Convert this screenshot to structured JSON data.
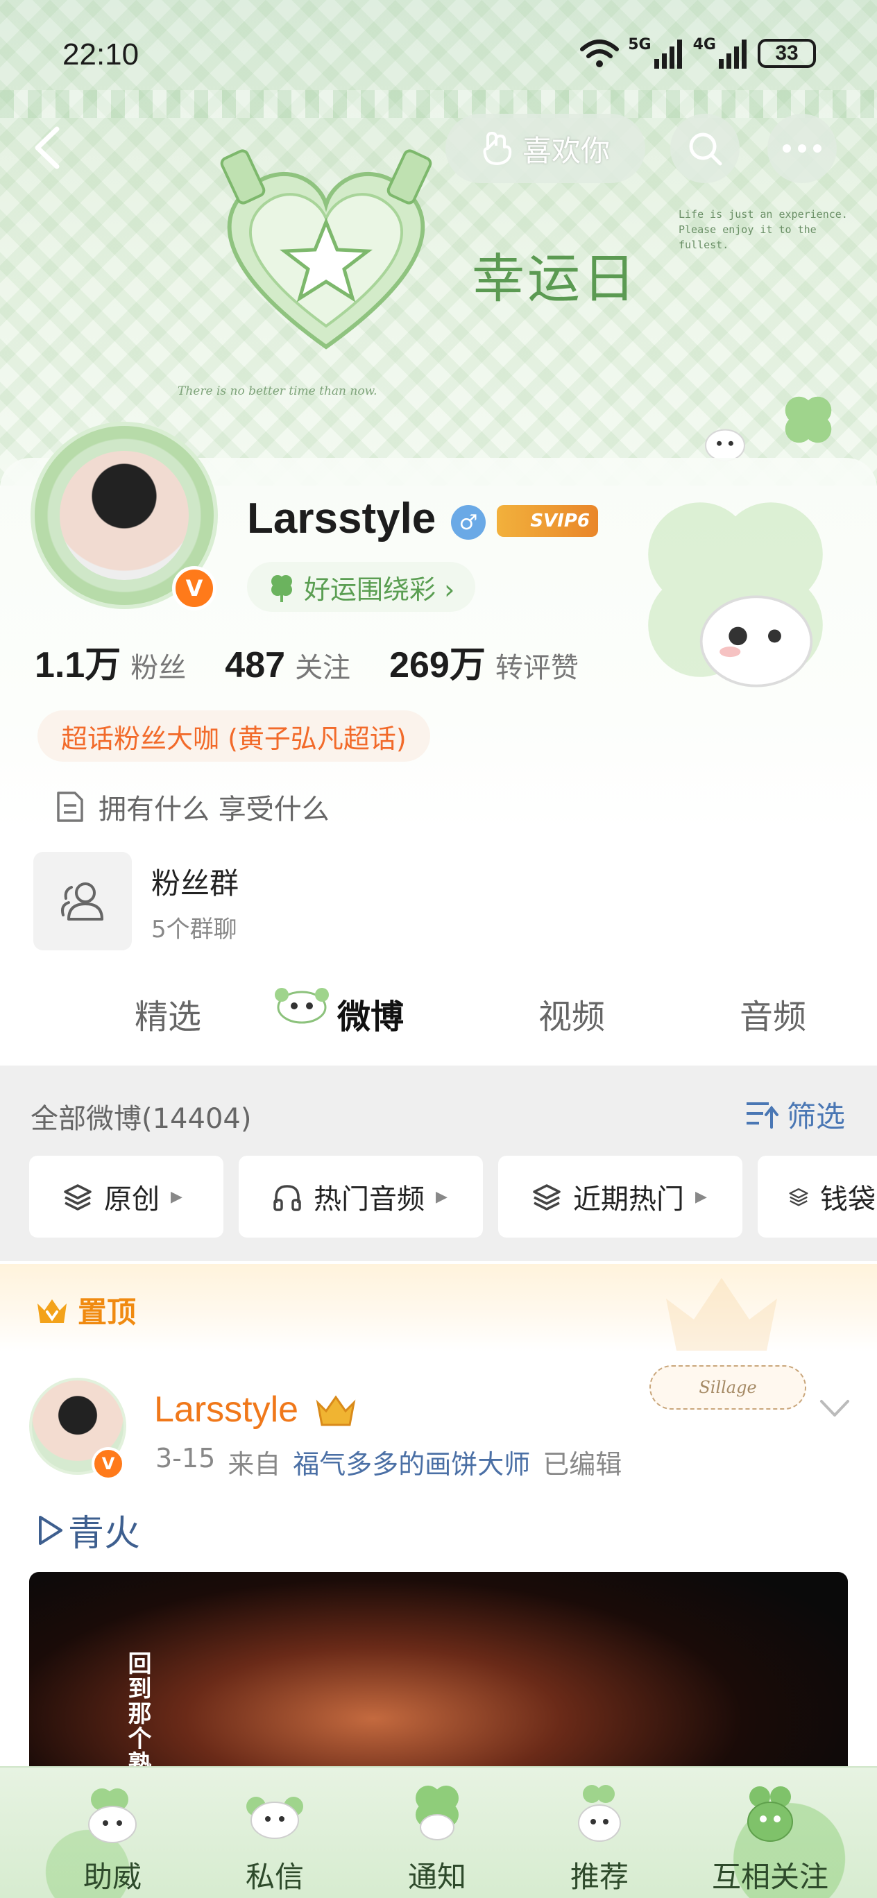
{
  "status_bar": {
    "time": "22:10",
    "net1": "5G",
    "net2": "4G",
    "battery": "33"
  },
  "header": {
    "like_label": "喜欢你",
    "banner_title": "幸运日",
    "banner_note": "Life is just an experience. Please enjoy it to the fullest.",
    "banner_note2": "There is no better time than now."
  },
  "profile": {
    "username": "Larsstyle",
    "gender": "♂",
    "svip": "SVIP6",
    "luck_pill": "好运围绕彩 ›",
    "stats": [
      {
        "num": "1.1万",
        "label": "粉丝"
      },
      {
        "num": "487",
        "label": "关注"
      },
      {
        "num": "269万",
        "label": "转评赞"
      }
    ],
    "fan_badge": "超话粉丝大咖 (黄子弘凡超话)",
    "benefit": "拥有什么 享受什么"
  },
  "fan_group": {
    "title": "粉丝群",
    "subtitle": "5个群聊"
  },
  "tabs": [
    "精选",
    "微博",
    "视频",
    "音频"
  ],
  "active_tab": "微博",
  "filter": {
    "all_count": "全部微博(14404)",
    "filter_label": "筛选",
    "chips": [
      "原创",
      "热门音频",
      "近期热门",
      "钱袋"
    ]
  },
  "pinned": {
    "label": "置顶",
    "user": "Larsstyle",
    "date": "3-15",
    "from_label": "来自",
    "source": "福气多多的画饼大师",
    "edited": "已编辑",
    "sillage": "Sillage",
    "title": "青火",
    "video_subtitle": "回到那个熟悉"
  },
  "bottom_bar": [
    "助威",
    "私信",
    "通知",
    "推荐",
    "互相关注"
  ],
  "colors": {
    "accent_orange": "#f0781a",
    "link_blue": "#4a77b4",
    "banner_green": "#5b9a52"
  }
}
